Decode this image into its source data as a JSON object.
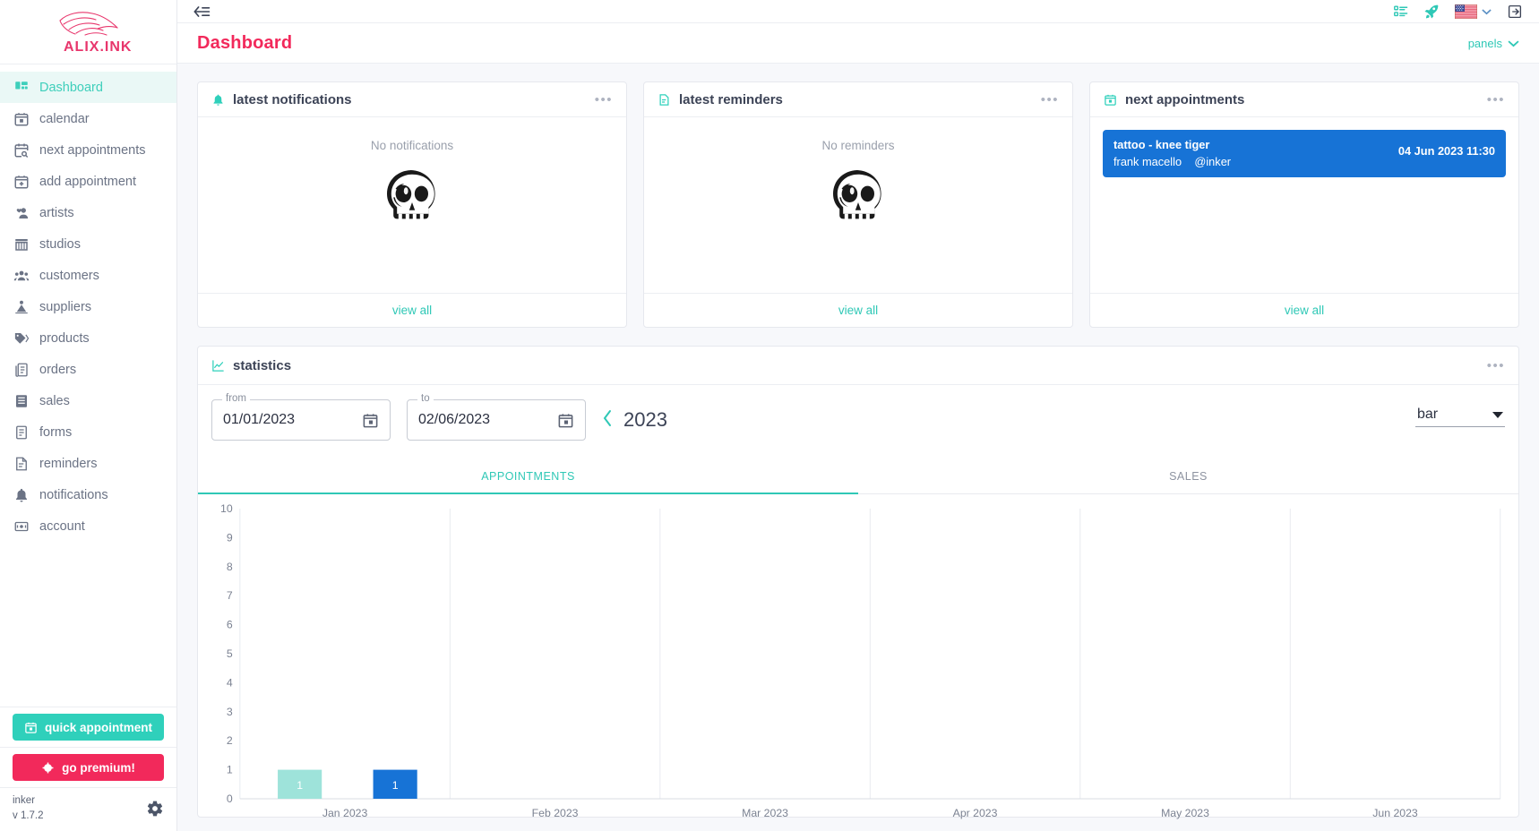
{
  "brand": {
    "logo_text": "ALIX.INK",
    "accent_pink": "#f2295b",
    "accent_teal": "#2fc8b6"
  },
  "sidebar": {
    "items": [
      {
        "label": "Dashboard",
        "icon": "dashboard-icon",
        "active": true
      },
      {
        "label": "calendar",
        "icon": "calendar-icon",
        "active": false
      },
      {
        "label": "next appointments",
        "icon": "calendar-search-icon",
        "active": false
      },
      {
        "label": "add appointment",
        "icon": "calendar-plus-icon",
        "active": false
      },
      {
        "label": "artists",
        "icon": "artist-icon",
        "active": false
      },
      {
        "label": "studios",
        "icon": "store-icon",
        "active": false
      },
      {
        "label": "customers",
        "icon": "people-icon",
        "active": false
      },
      {
        "label": "suppliers",
        "icon": "supplier-icon",
        "active": false
      },
      {
        "label": "products",
        "icon": "tag-icon",
        "active": false
      },
      {
        "label": "orders",
        "icon": "orders-icon",
        "active": false
      },
      {
        "label": "sales",
        "icon": "sales-icon",
        "active": false
      },
      {
        "label": "forms",
        "icon": "forms-icon",
        "active": false
      },
      {
        "label": "reminders",
        "icon": "reminder-icon",
        "active": false
      },
      {
        "label": "notifications",
        "icon": "bell-icon",
        "active": false
      },
      {
        "label": "account",
        "icon": "account-icon",
        "active": false
      }
    ],
    "quick_appointment_label": "quick appointment",
    "go_premium_label": "go premium!",
    "app_name": "inker",
    "version": "v 1.7.2"
  },
  "topbar": {
    "collapse_icon": "collapse-menu-icon",
    "tasks_icon": "checklist-icon",
    "rocket_icon": "rocket-icon",
    "flag_icon": "us-flag-icon",
    "logout_icon": "logout-icon"
  },
  "header": {
    "title": "Dashboard",
    "panels_label": "panels"
  },
  "cards": {
    "notifications": {
      "title": "latest notifications",
      "icon": "bell-icon",
      "empty_text": "No notifications",
      "view_all": "view all",
      "menu": "•••"
    },
    "reminders": {
      "title": "latest reminders",
      "icon": "reminder-doc-icon",
      "empty_text": "No reminders",
      "view_all": "view all",
      "menu": "•••"
    },
    "appointments": {
      "title": "next appointments",
      "icon": "calendar-icon",
      "view_all": "view all",
      "menu": "•••",
      "items": [
        {
          "title": "tattoo - knee tiger",
          "customer": "frank macello",
          "studio": "@inker",
          "datetime": "04 Jun 2023 11:30"
        }
      ]
    }
  },
  "statistics": {
    "title": "statistics",
    "icon": "chart-line-icon",
    "menu": "•••",
    "from_label": "from",
    "from_value": "01/01/2023",
    "to_label": "to",
    "to_value": "02/06/2023",
    "year": "2023",
    "prev_year_icon": "chevron-left-icon",
    "chart_type": "bar",
    "tabs": [
      {
        "label": "APPOINTMENTS",
        "active": true
      },
      {
        "label": "SALES",
        "active": false
      }
    ]
  },
  "chart_data": {
    "type": "bar",
    "title": "",
    "xlabel": "",
    "ylabel": "",
    "categories": [
      "Jan 2023",
      "Feb 2023",
      "Mar 2023",
      "Apr 2023",
      "May 2023",
      "Jun 2023"
    ],
    "ylim": [
      0,
      10
    ],
    "yticks": [
      0,
      1,
      2,
      3,
      4,
      5,
      6,
      7,
      8,
      9,
      10
    ],
    "grid": true,
    "legend": "none",
    "series": [
      {
        "name": "series-1",
        "color": "#9ee3da",
        "values": [
          1,
          0,
          0,
          0,
          0,
          0
        ]
      },
      {
        "name": "series-2",
        "color": "#1773d6",
        "values": [
          1,
          0,
          0,
          0,
          0,
          0
        ]
      }
    ],
    "data_labels": [
      {
        "category": "Jan 2023",
        "series": "series-1",
        "value": 1,
        "text": "1"
      },
      {
        "category": "Jan 2023",
        "series": "series-2",
        "value": 1,
        "text": "1"
      }
    ]
  }
}
